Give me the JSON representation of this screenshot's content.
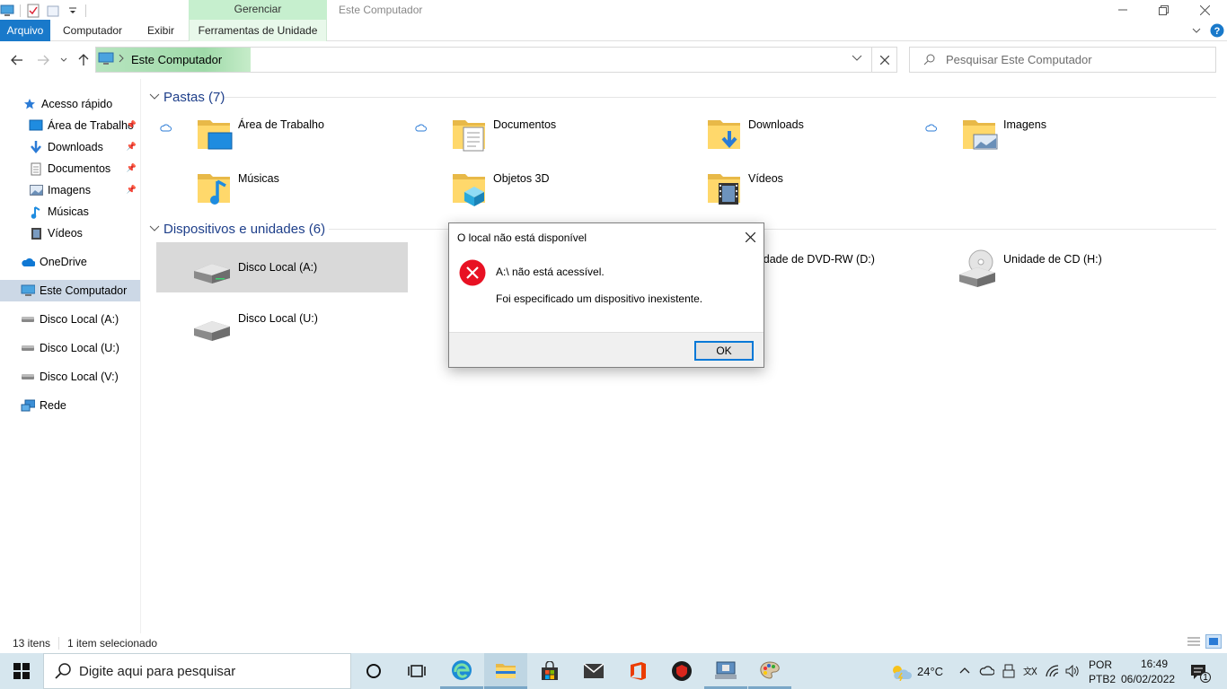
{
  "window": {
    "title": "Este Computador",
    "manage_tab_header": "Gerenciar"
  },
  "ribbon": {
    "tabs": [
      "Arquivo",
      "Computador",
      "Exibir",
      "Ferramentas de Unidade"
    ]
  },
  "address": {
    "breadcrumb": "Este Computador",
    "search_placeholder": "Pesquisar Este Computador"
  },
  "nav": {
    "quick_access": "Acesso rápido",
    "items": [
      {
        "label": "Área de Trabalho",
        "icon": "desktop-icon"
      },
      {
        "label": "Downloads",
        "icon": "download-icon"
      },
      {
        "label": "Documentos",
        "icon": "document-icon"
      },
      {
        "label": "Imagens",
        "icon": "picture-icon"
      },
      {
        "label": "Músicas",
        "icon": "music-icon"
      },
      {
        "label": "Vídeos",
        "icon": "video-icon"
      }
    ],
    "onedrive": "OneDrive",
    "this_pc": "Este Computador",
    "drives": [
      "Disco Local (A:)",
      "Disco Local (U:)",
      "Disco Local (V:)"
    ],
    "network": "Rede"
  },
  "content": {
    "folders_header": "Pastas (7)",
    "folders": [
      "Área de Trabalho",
      "Documentos",
      "Downloads",
      "Imagens",
      "Músicas",
      "Objetos 3D",
      "Vídeos"
    ],
    "devices_header": "Dispositivos e unidades (6)",
    "devices": [
      "Disco Local (A:)",
      "Disco Local (U:)",
      "idade de DVD-RW (D:)",
      "Unidade de CD (H:)"
    ]
  },
  "dialog": {
    "title": "O local não está disponível",
    "message": "A:\\ não está acessível.",
    "detail": "Foi especificado um dispositivo inexistente.",
    "ok_label": "OK"
  },
  "status": {
    "items_count": "13 itens",
    "selected": "1 item selecionado"
  },
  "taskbar": {
    "search_placeholder": "Digite aqui para pesquisar",
    "temperature": "24°C",
    "language": "POR",
    "layout": "PTB2",
    "time": "16:49",
    "date": "06/02/2022",
    "notifications": "1"
  },
  "colors": {
    "accent": "#1979ca",
    "manage_tab": "#c6efce",
    "selection": "#d9d9d9",
    "error_red": "#e81123",
    "taskbar": "#d6e6ee"
  }
}
